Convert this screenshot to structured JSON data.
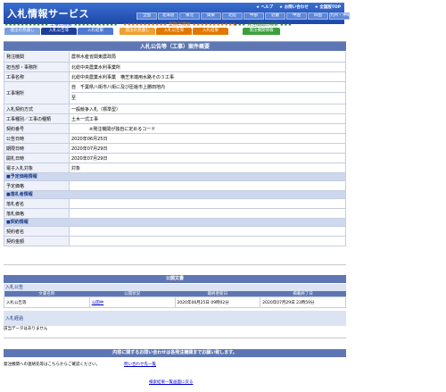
{
  "header": {
    "logo": "入札情報サービス",
    "util_links": [
      "★ ヘルプ",
      "★ お問い合わせ",
      "★ 全国版TOP"
    ],
    "regions": [
      "全国",
      "北海道",
      "東北",
      "関東",
      "北陸",
      "中部",
      "近畿",
      "中国",
      "四国",
      "九州・沖縄"
    ]
  },
  "categories": {
    "construction": {
      "stars_left": "★★★★★★★★★★★",
      "label": "工事の検索",
      "stars_right": "★★★★★★★★★★★"
    },
    "services": {
      "stars_left": "★★★★★★★★★★★",
      "label": "業務の検索",
      "stars_right": "★★★★★★★★★★★"
    },
    "orderer": {
      "stars_left": "★★★",
      "label": "発注機関の検索",
      "stars_right": "★★★"
    }
  },
  "tabs": [
    {
      "label": "発注の見通し",
      "color": "#7aa0e0"
    },
    {
      "label": "入札公告等",
      "color": "#1c3f9e"
    },
    {
      "label": "入札結果",
      "color": "#4f79d3"
    },
    {
      "label": "発注の見通し",
      "color": "#f0a030"
    },
    {
      "label": "入札公告等",
      "color": "#e07800"
    },
    {
      "label": "入札結果",
      "color": "#e07800"
    },
    {
      "label": "発注機関情報",
      "color": "#3aa03a"
    }
  ],
  "title": "入札公告等（工事）案件概要",
  "detail": {
    "agency_label": "発注機関",
    "agency": "農林水産省関東農政局",
    "office_label": "担当部・事務所",
    "office": "北総中央農業水利事業所",
    "work_name_label": "工事名称",
    "work_name": "北総中央農業水利事業　横芝末端用水路その３工事",
    "location_label": "工事場所",
    "location": "自　千葉県八街市八街に及び匝瑳市上勝田地内",
    "location_2": "至",
    "method_label": "入札契約方式",
    "method": "一般競争入札（標準型）",
    "category_label": "工事種別／工事の種類",
    "category": "土木一式工事",
    "code_label": "契約番号",
    "code": "　　　　※発注機関が独自に定めるコード",
    "notice_date_label": "公告日時",
    "notice_date": "2020年06月25日",
    "deadline_label": "期限日時",
    "deadline": "2020年07月29日",
    "open_date_label": "開札日時",
    "open_date": "2020年07月29日",
    "e_bid_label": "電子入札対象",
    "e_bid": "対象",
    "price_section": "■予定価格情報",
    "price_label": "予定価格",
    "price": "",
    "winner_section": "■落札者情報",
    "winner_label": "落札者名",
    "winner": "",
    "winner_price_label": "落札価格",
    "winner_price": "",
    "contract_section": "■契約情報",
    "contract_name_label": "契約者名",
    "contract_name": "",
    "contract_price_label": "契約金額",
    "contract_price": ""
  },
  "documents": {
    "bar": "公開文書",
    "section": "入札公告",
    "headers": [
      "文書名称",
      "公開状況",
      "最終更新日",
      "掲載終了日"
    ],
    "rows": [
      [
        "入札公告等",
        "公開中",
        "2020年06月25日 09時02分",
        "2020年07月29日 23時59分"
      ]
    ],
    "history": "入札経過",
    "history_none": "該当データはありません"
  },
  "notice": {
    "bar": "内容に関するお問い合わせは各発注機関までお願い致します。",
    "text": "発注機関への連絡先等はこちらからご確認ください。",
    "link": "問い合わせ先一覧"
  },
  "back": "検索結果一覧画面に戻る"
}
